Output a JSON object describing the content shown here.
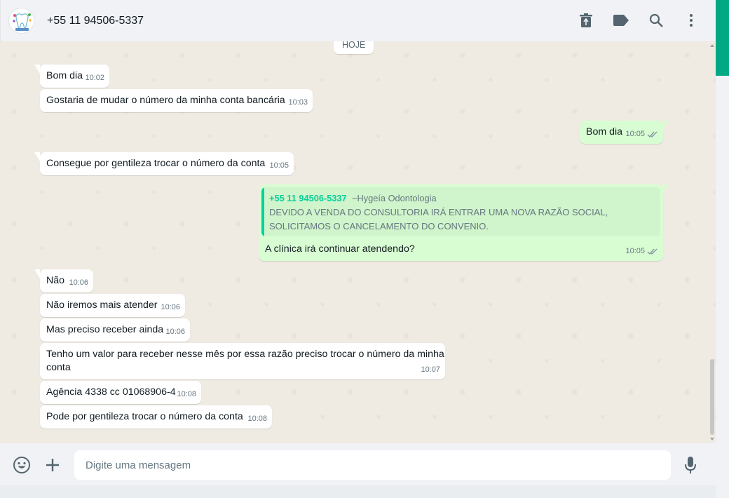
{
  "header": {
    "contact_name": "+55 11 94506-5337",
    "avatar_label": "hygeia",
    "icons": [
      "delete-icon",
      "label-icon",
      "search-icon",
      "menu-icon"
    ]
  },
  "chat": {
    "date_label": "HOJE",
    "messages": [
      {
        "dir": "in",
        "text": "Bom dia",
        "time": "10:02"
      },
      {
        "dir": "in",
        "text": "Gostaria de mudar o número da minha conta bancária",
        "time": "10:03"
      },
      {
        "dir": "out",
        "text": "Bom dia",
        "time": "10:05",
        "status": "read"
      },
      {
        "dir": "in",
        "text": "Consegue por gentileza trocar o número da conta",
        "time": "10:05"
      },
      {
        "dir": "out",
        "text": "A clínica irá continuar atendendo?",
        "time": "10:05",
        "status": "read",
        "quote": {
          "author": "+55 11 94506-5337",
          "pushname": "~Hygeía Odontologia",
          "line1": "DEVIDO A VENDA DO CONSULTORIA IRÁ ENTRAR UMA NOVA RAZÃO SOCIAL,",
          "line2": "SOLICITAMOS O CANCELAMENTO DO CONVENIO."
        }
      },
      {
        "dir": "in",
        "text": "Não",
        "time": "10:06"
      },
      {
        "dir": "in",
        "text": "Não iremos mais atender",
        "time": "10:06"
      },
      {
        "dir": "in",
        "text": "Mas preciso receber ainda",
        "time": "10:06"
      },
      {
        "dir": "in",
        "text_line1": "Tenho um valor para receber nesse mês por essa razão preciso trocar o número da minha",
        "text_line2": "conta",
        "time": "10:07"
      },
      {
        "dir": "in",
        "text": "Agência 4338 cc 01068906-4",
        "time": "10:08"
      },
      {
        "dir": "in",
        "text": "Pode por gentileza trocar o número da conta",
        "time": "10:08"
      }
    ]
  },
  "footer": {
    "placeholder": "Digite uma mensagem",
    "value": "",
    "icons": [
      "emoji-icon",
      "attach-plus-icon",
      "microphone-icon"
    ]
  },
  "colors": {
    "incoming_bubble": "#ffffff",
    "outgoing_bubble": "#d9fdd3",
    "accent": "#00a884",
    "quote_author": "#06cf9c",
    "chat_background": "#efeae2"
  }
}
